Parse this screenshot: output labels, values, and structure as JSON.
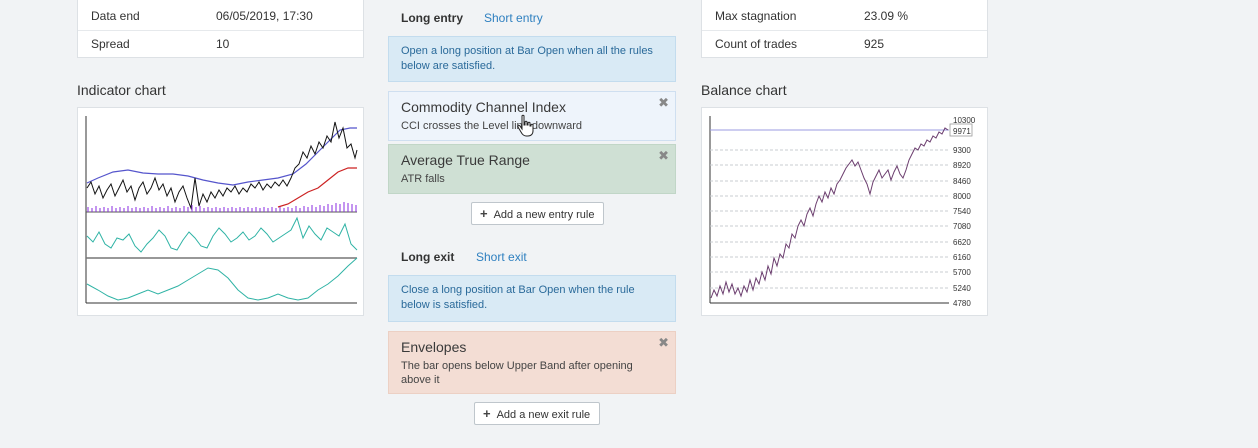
{
  "left_info": [
    {
      "key": "Data end",
      "value": "06/05/2019, 17:30"
    },
    {
      "key": "Spread",
      "value": "10"
    }
  ],
  "right_info": [
    {
      "key": "Max stagnation",
      "value": "23.09 %"
    },
    {
      "key": "Count of trades",
      "value": "925"
    }
  ],
  "indicator_chart": {
    "title": "Indicator chart"
  },
  "balance_chart": {
    "title": "Balance chart",
    "y_ticks": [
      "10300",
      "9300",
      "8920",
      "8460",
      "8000",
      "7540",
      "7080",
      "6620",
      "6160",
      "5700",
      "5240",
      "4780"
    ],
    "current_value": "9971"
  },
  "entry": {
    "tabs": {
      "long": "Long entry",
      "short": "Short entry"
    },
    "note": "Open a long position at Bar Open when all the rules below are satisfied.",
    "rules": [
      {
        "title": "Commodity Channel Index",
        "desc": "CCI crosses the Level line downward"
      },
      {
        "title": "Average True Range",
        "desc": "ATR falls"
      }
    ],
    "add_button": "Add a new entry rule"
  },
  "exit": {
    "tabs": {
      "long": "Long exit",
      "short": "Short exit"
    },
    "note": "Close a long position at Bar Open when the rule below is satisfied.",
    "rules": [
      {
        "title": "Envelopes",
        "desc": "The bar opens below Upper Band after opening above it"
      }
    ],
    "add_button": "Add a new exit rule"
  },
  "colors": {
    "note_bg": "#d9eaf5",
    "rule_blue": "#eef4fb",
    "rule_green": "#cfe0d4",
    "rule_red": "#f3ddd4",
    "link": "#2f80c0"
  }
}
